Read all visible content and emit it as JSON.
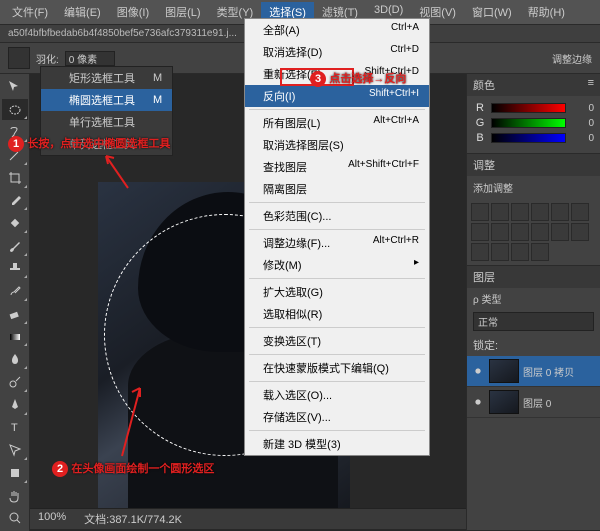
{
  "menubar": [
    "文件(F)",
    "编辑(E)",
    "图像(I)",
    "图层(L)",
    "类型(Y)",
    "选择(S)",
    "滤镜(T)",
    "3D(D)",
    "视图(V)",
    "窗口(W)",
    "帮助(H)"
  ],
  "menubar_active": 5,
  "doc_title": "a50f4bfbfbedab6b4f4850bef5e736afc379311e91.j...",
  "options": {
    "feather_label": "羽化:",
    "feather_value": "0 像素",
    "adjust_edge": "调整边缘"
  },
  "flyout": {
    "items": [
      {
        "label": "矩形选框工具",
        "key": "M"
      },
      {
        "label": "椭圆选框工具",
        "key": "M"
      },
      {
        "label": "单行选框工具",
        "key": ""
      },
      {
        "label": "单列选框工具",
        "key": ""
      }
    ],
    "selected": 1
  },
  "dropdown": {
    "groups": [
      [
        {
          "l": "全部(A)",
          "k": "Ctrl+A"
        },
        {
          "l": "取消选择(D)",
          "k": "Ctrl+D"
        },
        {
          "l": "重新选择(E)",
          "k": "Shift+Ctrl+D"
        },
        {
          "l": "反向(I)",
          "k": "Shift+Ctrl+I"
        }
      ],
      [
        {
          "l": "所有图层(L)",
          "k": "Alt+Ctrl+A"
        },
        {
          "l": "取消选择图层(S)",
          "k": ""
        },
        {
          "l": "查找图层",
          "k": "Alt+Shift+Ctrl+F"
        },
        {
          "l": "隔离图层",
          "k": ""
        }
      ],
      [
        {
          "l": "色彩范围(C)...",
          "k": ""
        }
      ],
      [
        {
          "l": "调整边缘(F)...",
          "k": "Alt+Ctrl+R"
        },
        {
          "l": "修改(M)",
          "k": "▸"
        }
      ],
      [
        {
          "l": "扩大选取(G)",
          "k": ""
        },
        {
          "l": "选取相似(R)",
          "k": ""
        }
      ],
      [
        {
          "l": "变换选区(T)",
          "k": ""
        }
      ],
      [
        {
          "l": "在快速蒙版模式下编辑(Q)",
          "k": ""
        }
      ],
      [
        {
          "l": "载入选区(O)...",
          "k": ""
        },
        {
          "l": "存储选区(V)...",
          "k": ""
        }
      ],
      [
        {
          "l": "新建 3D 模型(3)",
          "k": ""
        }
      ]
    ],
    "hover": "反向(I)"
  },
  "annotations": {
    "a1": "长按，点击选中椭圆选框工具",
    "a2": "在头像画面绘制一个圆形选区",
    "a3": "点击选择→反向"
  },
  "panels": {
    "color_tab": "颜色",
    "rgb": {
      "R": "0",
      "G": "0",
      "B": "0"
    },
    "adjust_title": "调整",
    "adjust_sub": "添加调整",
    "layers_tab": "图层",
    "blend": "正常",
    "lock_label": "锁定:",
    "layer_names": [
      "图层 0 拷贝",
      "图层 0"
    ]
  },
  "status": {
    "zoom": "100%",
    "docsize": "文档:387.1K/774.2K"
  }
}
